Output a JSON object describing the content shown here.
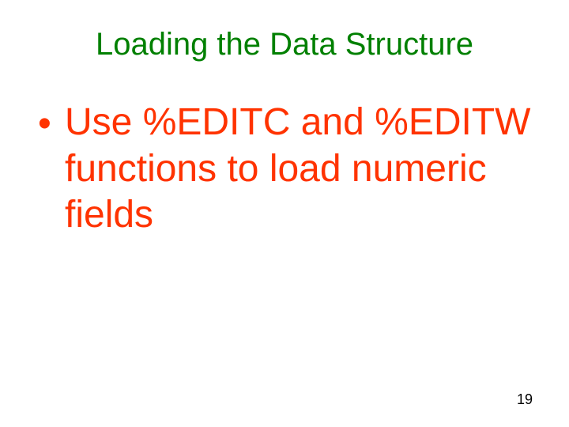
{
  "slide": {
    "title": "Loading the Data Structure",
    "bullet": "Use %EDITC and %EDITW functions to load numeric fields",
    "page_number": "19"
  }
}
